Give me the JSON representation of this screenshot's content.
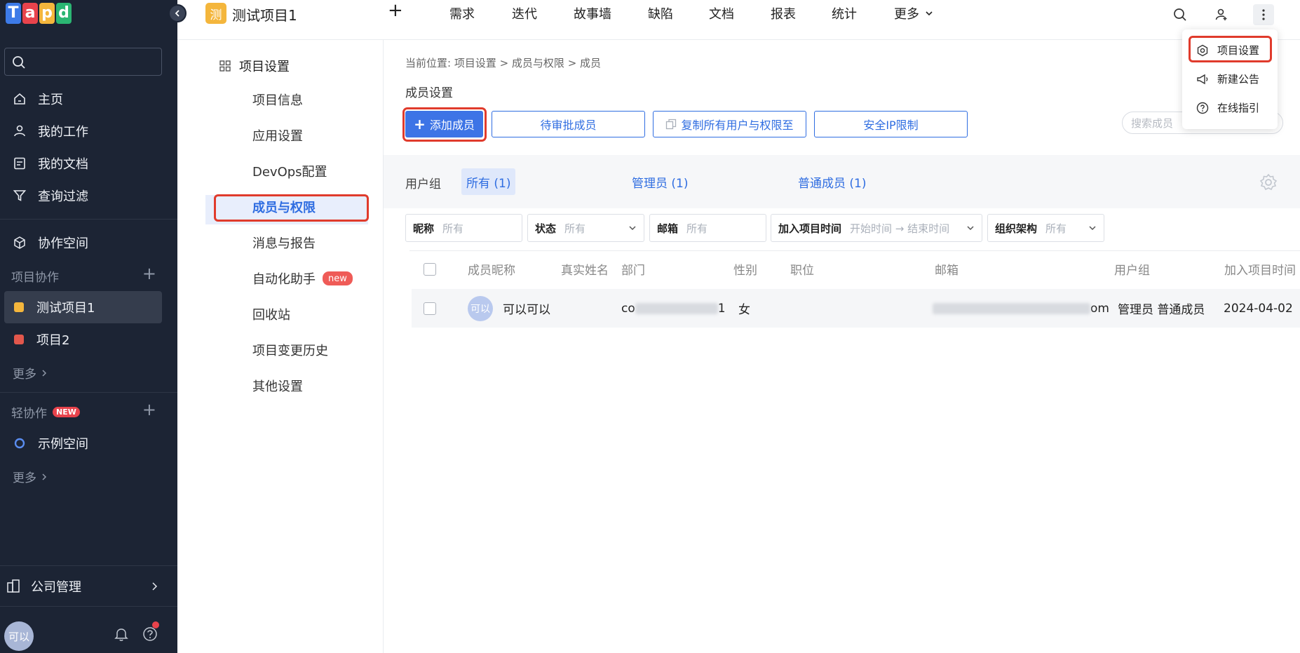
{
  "sidebar": {
    "logo": [
      "T",
      "a",
      "p",
      "d"
    ],
    "nav": [
      {
        "label": "主页",
        "icon": "home-icon"
      },
      {
        "label": "我的工作",
        "icon": "user-icon"
      },
      {
        "label": "我的文档",
        "icon": "document-icon"
      },
      {
        "label": "查询过滤",
        "icon": "filter-icon"
      }
    ],
    "workspace": {
      "label": "协作空间",
      "icon": "cube-icon"
    },
    "project_section": "项目协作",
    "projects": [
      {
        "label": "测试项目1",
        "color": "#f4b63c",
        "active": true
      },
      {
        "label": "项目2",
        "color": "#e2574c",
        "active": false
      }
    ],
    "more1": "更多",
    "light_section": "轻协作",
    "light_badge": "NEW",
    "light_items": [
      {
        "label": "示例空间"
      }
    ],
    "more2": "更多",
    "company": "公司管理",
    "avatar": "可以"
  },
  "topbar": {
    "project_badge": "测",
    "project_title": "测试项目1",
    "plus": "+",
    "nav": [
      "需求",
      "迭代",
      "故事墙",
      "缺陷",
      "文档",
      "报表",
      "统计",
      "更多"
    ]
  },
  "settings": {
    "title": "项目设置",
    "items": [
      "项目信息",
      "应用设置",
      "DevOps配置",
      "成员与权限",
      "消息与报告",
      "自动化助手",
      "回收站",
      "项目变更历史",
      "其他设置"
    ],
    "new_badge": "new"
  },
  "main": {
    "breadcrumb": "当前位置:  项目设置 > 成员与权限 > 成员",
    "section_title": "成员设置",
    "buttons": {
      "add": "添加成员",
      "pending": "待审批成员",
      "copy": "复制所有用户与权限至",
      "ip": "安全IP限制"
    },
    "search_placeholder": "搜索成员",
    "group_label": "用户组",
    "groups": [
      "所有 (1)",
      "管理员 (1)",
      "普通成员 (1)"
    ],
    "filters": [
      {
        "label": "昵称",
        "value": "所有"
      },
      {
        "label": "状态",
        "value": "所有"
      },
      {
        "label": "邮箱",
        "value": "所有"
      },
      {
        "label": "加入项目时间",
        "value": "开始时间 → 结束时间"
      },
      {
        "label": "组织架构",
        "value": "所有"
      }
    ],
    "columns": [
      "成员昵称",
      "真实姓名",
      "部门",
      "性别",
      "职位",
      "邮箱",
      "用户组",
      "加入项目时间"
    ],
    "row": {
      "avatar": "可以",
      "nickname": "可以可以",
      "dept_start": "co",
      "dept_end": "1",
      "gender": "女",
      "email_end": "om",
      "groups": "管理员 普通成员",
      "join_date": "2024-04-02"
    }
  },
  "dropdown": {
    "items": [
      {
        "label": "项目设置",
        "icon": "settings-icon"
      },
      {
        "label": "新建公告",
        "icon": "megaphone-icon"
      },
      {
        "label": "在线指引",
        "icon": "help-icon"
      }
    ]
  },
  "colors": {
    "sidebar_bg": "#1c2434",
    "accent": "#2f6de1",
    "highlight": "#e03b2c"
  }
}
